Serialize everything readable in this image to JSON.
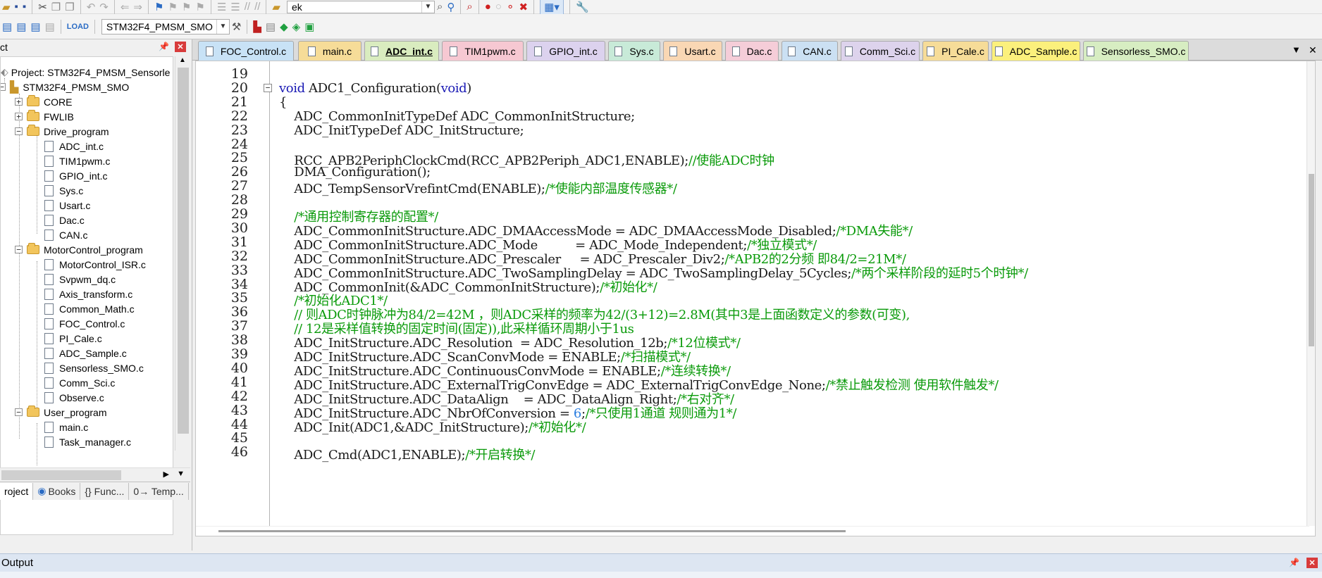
{
  "toolbar": {
    "target_combo": "STM32F4_PMSM_SMO",
    "search_combo": "ek"
  },
  "project_panel": {
    "title": "ct",
    "root": "Project: STM32F4_PMSM_Sensorle",
    "target": "STM32F4_PMSM_SMO",
    "groups": [
      {
        "label": "CORE",
        "expanded": false
      },
      {
        "label": "FWLIB",
        "expanded": false
      },
      {
        "label": "Drive_program",
        "expanded": true,
        "files": [
          "ADC_int.c",
          "TIM1pwm.c",
          "GPIO_int.c",
          "Sys.c",
          "Usart.c",
          "Dac.c",
          "CAN.c"
        ]
      },
      {
        "label": "MotorControl_program",
        "expanded": true,
        "files": [
          "MotorControl_ISR.c",
          "Svpwm_dq.c",
          "Axis_transform.c",
          "Common_Math.c",
          "FOC_Control.c",
          "PI_Cale.c",
          "ADC_Sample.c",
          "Sensorless_SMO.c",
          "Comm_Sci.c",
          "Observe.c"
        ]
      },
      {
        "label": "User_program",
        "expanded": true,
        "files": [
          "main.c",
          "Task_manager.c"
        ]
      }
    ],
    "tabs": [
      "roject",
      "Books",
      "{} Func...",
      "0→ Temp..."
    ]
  },
  "editor": {
    "tabs": [
      {
        "label": "FOC_Control.c",
        "color": "#c8e2f6",
        "active": false
      },
      {
        "label": "main.c",
        "color": "#f6dc98",
        "active": false
      },
      {
        "label": "ADC_int.c",
        "color": "#d9ecbf",
        "active": true
      },
      {
        "label": "TIM1pwm.c",
        "color": "#f6c8d2",
        "active": false
      },
      {
        "label": "GPIO_int.c",
        "color": "#dcd2ee",
        "active": false
      },
      {
        "label": "Sys.c",
        "color": "#c8ead8",
        "active": false
      },
      {
        "label": "Usart.c",
        "color": "#f9d7b4",
        "active": false
      },
      {
        "label": "Dac.c",
        "color": "#f5cdd8",
        "active": false
      },
      {
        "label": "CAN.c",
        "color": "#cbe0f3",
        "active": false
      },
      {
        "label": "Comm_Sci.c",
        "color": "#ddd3ec",
        "active": false
      },
      {
        "label": "PI_Cale.c",
        "color": "#f6dc98",
        "active": false
      },
      {
        "label": "ADC_Sample.c",
        "color": "#fbf07c",
        "active": false
      },
      {
        "label": "Sensorless_SMO.c",
        "color": "#d7edc2",
        "active": false
      }
    ],
    "lines": [
      {
        "n": "19",
        "t": "",
        "c": ""
      },
      {
        "n": "20",
        "t": "void ADC1_Configuration(void)",
        "c": ""
      },
      {
        "n": "21",
        "t": "{",
        "c": ""
      },
      {
        "n": "22",
        "t": "    ADC_CommonInitTypeDef ADC_CommonInitStructure;",
        "c": ""
      },
      {
        "n": "23",
        "t": "    ADC_InitTypeDef ADC_InitStructure;",
        "c": ""
      },
      {
        "n": "24",
        "t": "",
        "c": ""
      },
      {
        "n": "25",
        "t": "    RCC_APB2PeriphClockCmd(RCC_APB2Periph_ADC1,ENABLE);",
        "c": "//使能ADC时钟"
      },
      {
        "n": "26",
        "t": "    DMA_Configuration();",
        "c": ""
      },
      {
        "n": "27",
        "t": "    ADC_TempSensorVrefintCmd(ENABLE);",
        "c": "/*使能内部温度传感器*/"
      },
      {
        "n": "28",
        "t": "",
        "c": ""
      },
      {
        "n": "29",
        "t": "    ",
        "c": "/*通用控制寄存器的配置*/"
      },
      {
        "n": "30",
        "t": "    ADC_CommonInitStructure.ADC_DMAAccessMode = ADC_DMAAccessMode_Disabled;",
        "c": "/*DMA失能*/"
      },
      {
        "n": "31",
        "t": "    ADC_CommonInitStructure.ADC_Mode          = ADC_Mode_Independent;",
        "c": "/*独立模式*/"
      },
      {
        "n": "32",
        "t": "    ADC_CommonInitStructure.ADC_Prescaler     = ADC_Prescaler_Div2;",
        "c": "/*APB2的2分频 即84/2=21M*/"
      },
      {
        "n": "33",
        "t": "    ADC_CommonInitStructure.ADC_TwoSamplingDelay = ADC_TwoSamplingDelay_5Cycles;",
        "c": "/*两个采样阶段的延时5个时钟*/"
      },
      {
        "n": "34",
        "t": "    ADC_CommonInit(&ADC_CommonInitStructure);",
        "c": "/*初始化*/"
      },
      {
        "n": "35",
        "t": "    ",
        "c": "/*初始化ADC1*/"
      },
      {
        "n": "36",
        "t": "    ",
        "c": "// 则ADC时钟脉冲为84/2=42M ，则ADC采样的频率为42/(3+12)=2.8M(其中3是上面函数定义的参数(可变),"
      },
      {
        "n": "37",
        "t": "    ",
        "c": "// 12是采样值转换的固定时间(固定)),此采样循环周期小于1us"
      },
      {
        "n": "38",
        "t": "    ADC_InitStructure.ADC_Resolution  = ADC_Resolution_12b;",
        "c": "/*12位模式*/"
      },
      {
        "n": "39",
        "t": "    ADC_InitStructure.ADC_ScanConvMode = ENABLE;",
        "c": "/*扫描模式*/"
      },
      {
        "n": "40",
        "t": "    ADC_InitStructure.ADC_ContinuousConvMode = ENABLE;",
        "c": "/*连续转换*/"
      },
      {
        "n": "41",
        "t": "    ADC_InitStructure.ADC_ExternalTrigConvEdge = ADC_ExternalTrigConvEdge_None;",
        "c": "/*禁止触发检测 使用软件触发*/"
      },
      {
        "n": "42",
        "t": "    ADC_InitStructure.ADC_DataAlign    = ADC_DataAlign_Right;",
        "c": "/*右对齐*/"
      },
      {
        "n": "43",
        "t": "    ADC_InitStructure.ADC_NbrOfConversion = 6;",
        "c": "/*只使用1通道 规则通为1*/"
      },
      {
        "n": "44",
        "t": "    ADC_Init(ADC1,&ADC_InitStructure);",
        "c": "/*初始化*/"
      },
      {
        "n": "45",
        "t": "",
        "c": ""
      },
      {
        "n": "46",
        "t": "    ADC_Cmd(ADC1,ENABLE);",
        "c": "/*开启转换*/"
      }
    ]
  },
  "output": {
    "title": "Output"
  }
}
